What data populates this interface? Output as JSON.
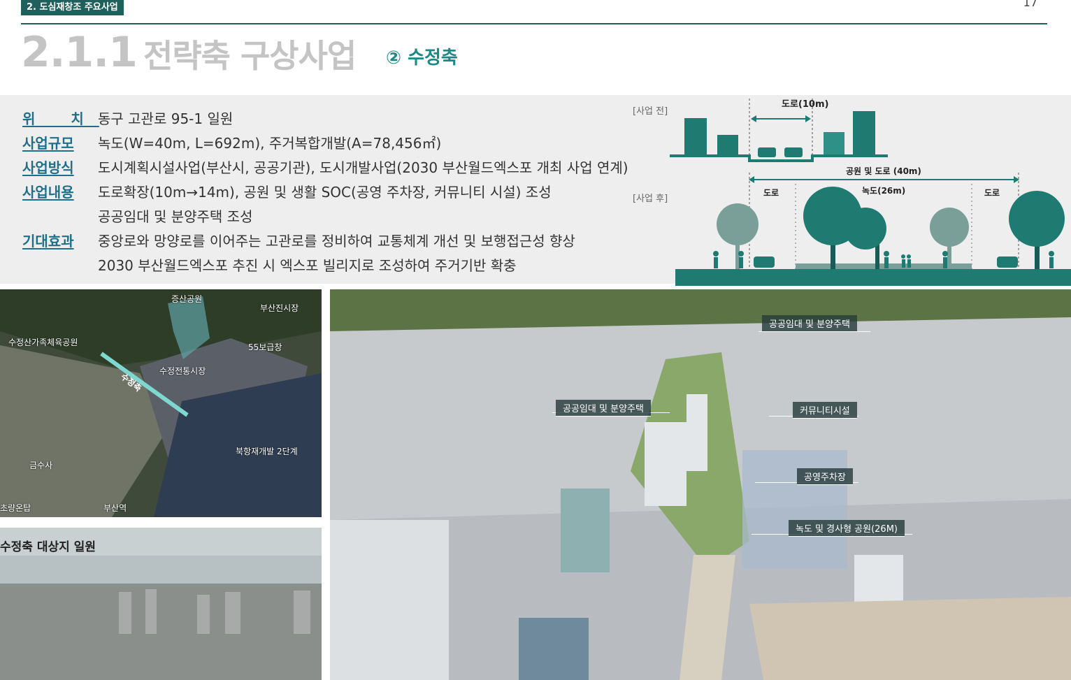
{
  "header": {
    "section_tag": "2. 도심재창조 주요사업",
    "page_number": "17",
    "title_number": "2.1.1",
    "title_main": "전략축 구상사업",
    "title_sub": "② 수정축"
  },
  "info": [
    {
      "label": "위 치",
      "value": "동구 고관로 95-1 일원"
    },
    {
      "label": "사업규모",
      "value": "녹도(W=40m, L=692m), 주거복합개발(A=78,456㎡)"
    },
    {
      "label": "사업방식",
      "value": "도시계획시설사업(부산시, 공공기관), 도시개발사업(2030 부산월드엑스포 개최 사업 연계)"
    },
    {
      "label": "사업내용",
      "value": "도로확장(10m→14m), 공원 및 생활 SOC(공영 주차장, 커뮤니티 시설) 조성"
    },
    {
      "label": "",
      "value": "공공임대 및 분양주택 조성"
    },
    {
      "label": "기대효과",
      "value": "중앙로와 망양로를 이어주는 고관로를 정비하여 교통체계 개선 및 보행접근성 향상"
    },
    {
      "label": "",
      "value": "2030 부산월드엑스포 추진 시 엑스포 빌리지로 조성하여 주거기반 확충"
    }
  ],
  "diagram": {
    "before_label": "[사업 전]",
    "road_before": "도로(10m)",
    "after_label": "[사업 후]",
    "total_width": "공원 및 도로 (40m)",
    "road_left": "도로",
    "greenway": "녹도(26m)",
    "road_right": "도로",
    "colors": {
      "teal": "#1f7a72",
      "teal_light": "#2f9088",
      "dark": "#1a5c55",
      "tree_gray": "#7a9e98"
    }
  },
  "map": {
    "labels": [
      "증산공원",
      "부산진시장",
      "수정산가족체육공원",
      "55보급창",
      "수정전통시장",
      "수정축",
      "북항재개발 2단계",
      "금수사",
      "초량온탑",
      "부산역"
    ]
  },
  "city_photo": {
    "caption": "수정축 대상지 일원"
  },
  "render": {
    "callouts": [
      "공공임대 및 분양주택",
      "공공임대 및 분양주택",
      "커뮤니티시설",
      "공영주차장",
      "녹도 및 경사형 공원(26M)"
    ]
  }
}
